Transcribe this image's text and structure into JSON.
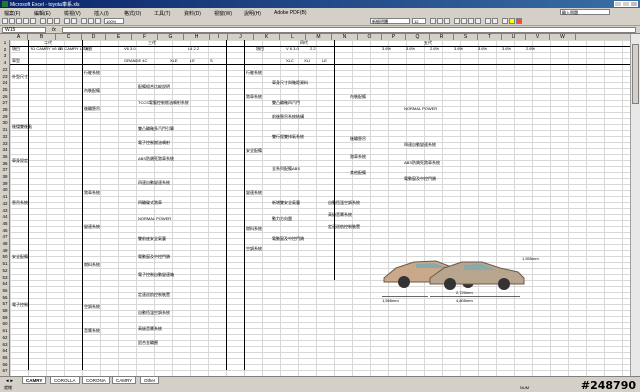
{
  "window": {
    "title": "Microsoft Excel - toyota車系.xls"
  },
  "menu": [
    "檔案(F)",
    "編輯(E)",
    "檢視(V)",
    "插入(I)",
    "格式(O)",
    "工具(T)",
    "資料(D)",
    "視窗(W)",
    "說明(H)",
    "Adobe PDF(B)"
  ],
  "toolbar": {
    "font_name": "新細明體",
    "font_size": "12",
    "zoom": "100%",
    "ask_box": "輸入問題"
  },
  "formula": {
    "cell_ref": "W15",
    "fx": "fx"
  },
  "columns": [
    "A",
    "B",
    "C",
    "D",
    "E",
    "F",
    "G",
    "H",
    "I",
    "J",
    "K",
    "L",
    "M",
    "N",
    "O",
    "P",
    "Q",
    "R",
    "S",
    "T",
    "U",
    "V",
    "W"
  ],
  "rows": [
    "1",
    "2",
    "3",
    "4",
    "22",
    "23",
    "24",
    "25",
    "26",
    "27",
    "28",
    "29",
    "30",
    "31",
    "32",
    "33",
    "34",
    "35",
    "36",
    "37",
    "38",
    "39",
    "40",
    "41",
    "42",
    "43",
    "44",
    "45",
    "46",
    "47",
    "48",
    "49",
    "50",
    "51",
    "52",
    "53",
    "54",
    "55",
    "56",
    "57",
    "58",
    "59",
    "60",
    "61",
    "62",
    "63",
    "64",
    "65",
    "66",
    "67"
  ],
  "sheet": {
    "gen_two": "二代",
    "gen_three": "三代",
    "gen_four": "四代",
    "gen_five": "五代",
    "item_label": "項目",
    "model_label": "車型",
    "b2": "'91 CAMRY V6 LE",
    "c2": "'91 CAMRY LE 6 E",
    "d2": "項目",
    "v6_30": "V6 3.0",
    "l4_22": "L4 2.2",
    "grande": "GRANDE 4C",
    "xle": "XLE",
    "le": "LE",
    "s": "S",
    "v6_30b": "V 6  3.0",
    "l22": "2.2",
    "xlc": "XLC",
    "xli": "XLI",
    "le2": "LE",
    "pct": [
      "3.6%",
      "3.6%",
      "2.6%",
      "3.6%",
      "3.6%",
      "3.6%",
      "2.6%"
    ],
    "item_rows": [
      "外型尺寸",
      "後擋雙後點",
      "車身設定",
      "懸吊系統",
      "安全配備",
      "電子控制",
      "行駛系統",
      "內裝配備",
      "後輪懸吊",
      "煞車系統",
      "變速系統",
      "燃料系統",
      "空調系統",
      "音響系統",
      "其他配備"
    ],
    "spec_lines": [
      "配備組合比較說明",
      "雙凸輪軸多汽門引擎",
      "車身尺寸與軸距資料",
      "前後懸吊系統結構",
      "電子控制燃油噴射",
      "ABS防鎖死煞車系統",
      "四速自動變速系統",
      "四輪碟式煞車",
      "雙前座安全氣囊",
      "電動窗及中控門鎖",
      "定速巡航控制裝置",
      "自動恆溫空調系統",
      "高級音響系統",
      "鋁合金輪圈"
    ],
    "notes": [
      "TCCS電腦控制燃油噴射系統",
      "雙凸輪軸四汽門",
      "NORMAL POWER",
      "雙行程雙排氣系統",
      "電子控制自動變速箱",
      "全系列配備ABS",
      "新增雙安全氣囊",
      "動力方向盤"
    ],
    "dims": [
      "1,556mm",
      "1,555mm",
      "2,720mm",
      "4,805mm"
    ]
  },
  "tabs": [
    "CAMRY",
    "COROLLA",
    "CORONA",
    "CAMRY",
    "Other"
  ],
  "tab_active_index": 0,
  "status": {
    "left": "就緒",
    "right": "NUM"
  },
  "watermark": "#248790"
}
